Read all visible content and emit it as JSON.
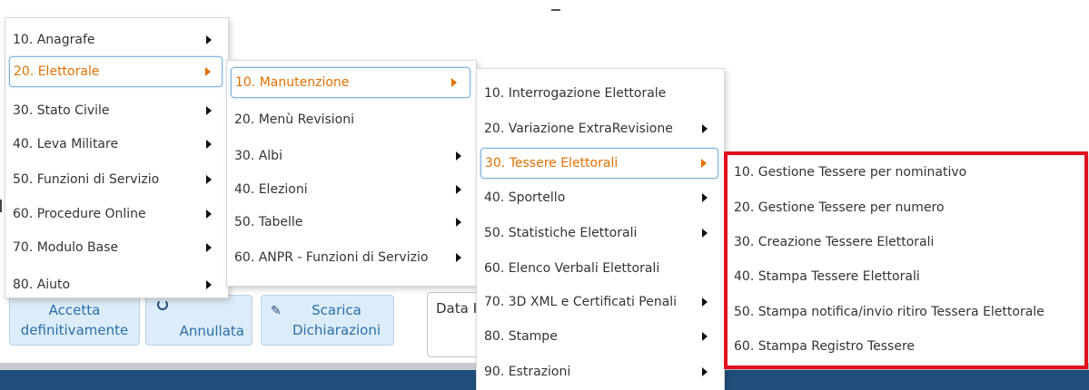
{
  "toolbar": {
    "accetta": [
      "Accetta",
      "definitivamente"
    ],
    "annullata": "Annullata",
    "scarica": [
      "Scarica",
      "Dichiarazioni"
    ],
    "data_label": "Data I"
  },
  "menu1": [
    {
      "label": "10. Anagrafe",
      "arrow": true
    },
    {
      "label": "20. Elettorale",
      "arrow": true,
      "active": true
    },
    {
      "label": "30. Stato Civile",
      "arrow": true
    },
    {
      "label": "40. Leva Militare",
      "arrow": true
    },
    {
      "label": "50. Funzioni di Servizio",
      "arrow": true
    },
    {
      "label": "60. Procedure Online",
      "arrow": true
    },
    {
      "label": "70. Modulo Base",
      "arrow": true
    },
    {
      "label": "80. Aiuto",
      "arrow": true
    }
  ],
  "menu2": [
    {
      "label": "10. Manutenzione",
      "arrow": true,
      "active": true
    },
    {
      "label": "20. Menù Revisioni",
      "arrow": false
    },
    {
      "label": "30. Albi",
      "arrow": true
    },
    {
      "label": "40. Elezioni",
      "arrow": true
    },
    {
      "label": "50. Tabelle",
      "arrow": true
    },
    {
      "label": "60. ANPR - Funzioni di Servizio",
      "arrow": true
    }
  ],
  "menu3": [
    {
      "label": "10. Interrogazione Elettorale",
      "arrow": false
    },
    {
      "label": "20. Variazione ExtraRevisione",
      "arrow": true
    },
    {
      "label": "30. Tessere Elettorali",
      "arrow": true,
      "active": true
    },
    {
      "label": "40. Sportello",
      "arrow": true
    },
    {
      "label": "50. Statistiche Elettorali",
      "arrow": true
    },
    {
      "label": "60. Elenco Verbali Elettorali",
      "arrow": false
    },
    {
      "label": "70. 3D XML e Certificati Penali",
      "arrow": true
    },
    {
      "label": "80. Stampe",
      "arrow": true
    },
    {
      "label": "90. Estrazioni",
      "arrow": true
    }
  ],
  "menu4": [
    {
      "label": "10. Gestione Tessere per nominativo",
      "arrow": false
    },
    {
      "label": "20. Gestione Tessere per numero",
      "arrow": false
    },
    {
      "label": "30. Creazione Tessere Elettorali",
      "arrow": false
    },
    {
      "label": "40. Stampa Tessere Elettorali",
      "arrow": false
    },
    {
      "label": "50. Stampa notifica/invio ritiro Tessera Elettorale",
      "arrow": false
    },
    {
      "label": "60. Stampa Registro Tessere",
      "arrow": false
    }
  ],
  "colors": {
    "active_text": "#e07000",
    "highlight_box": "#e0101e",
    "active_border": "#7fb2dc"
  }
}
